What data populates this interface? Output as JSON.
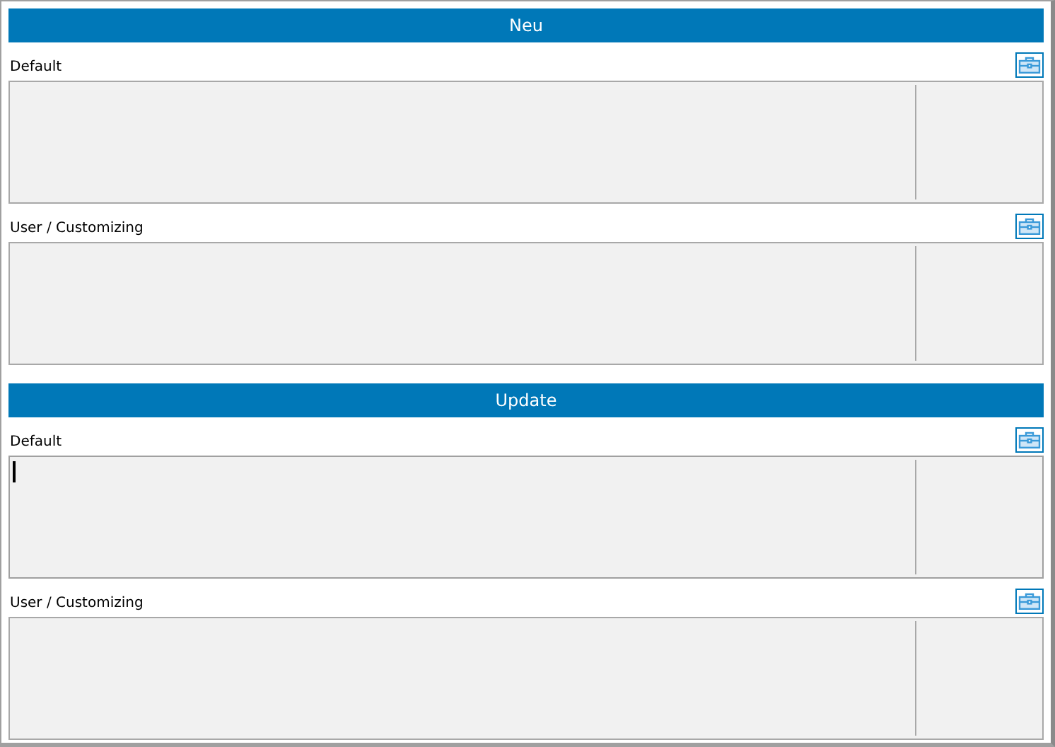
{
  "sections": [
    {
      "title": "Neu",
      "groups": [
        {
          "label": "Default",
          "focused": false
        },
        {
          "label": "User / Customizing",
          "focused": false
        }
      ]
    },
    {
      "title": "Update",
      "groups": [
        {
          "label": "Default",
          "focused": true
        },
        {
          "label": "User / Customizing",
          "focused": false
        }
      ]
    }
  ]
}
